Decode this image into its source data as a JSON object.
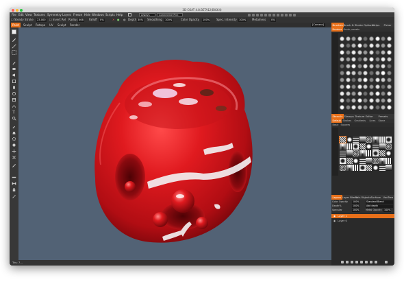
{
  "window": {
    "title": "3D-COAT 4.8.BETA12(BIG64)"
  },
  "menu": {
    "items": [
      "File",
      "Edit",
      "View",
      "Textures",
      "Symmetry",
      "Layers",
      "Freeze",
      "Hide",
      "Windows",
      "Scripts",
      "Help"
    ],
    "workspace_mode": "Always",
    "connective_label": "Connective Pick"
  },
  "tool_options": {
    "steady_label": "Steady Stroke",
    "steady_value": "23.000",
    "invert_label": "Invert Rel",
    "radius_label": "Radius",
    "radius_value": "468",
    "falloff_label": "Falloff",
    "falloff_value": "0%",
    "depth_label": "Depth",
    "depth_value": "30%",
    "smoothing_label": "Smoothing",
    "smoothing_value": "100%",
    "color_opacity_label": "Color Opacity",
    "color_opacity_value": "100%",
    "spec_intensity_label": "Spec. Intensity",
    "spec_intensity_value": "100%",
    "metalness_label": "Metalness",
    "metalness_value": "0%"
  },
  "rooms": [
    "Paint",
    "Sculpt",
    "Retopo",
    "UV",
    "Sculpt",
    "Render"
  ],
  "camera_label": "[Camera]",
  "status_text": "Tris: 7…",
  "right_panel": {
    "top_tabs": [
      "Brushes",
      "Brush & Stroke Options",
      "Strips",
      "Picker"
    ],
    "brush_subtabs": [
      "Brushes",
      "Brush presets"
    ],
    "stroke_tabs": [
      "Stencils",
      "Stamps",
      "Texture Editor",
      "Presets"
    ],
    "stroke_subtabs": [
      "Default",
      "Strokes",
      "Gradients",
      "Lines",
      "Stone"
    ],
    "stroke_subtab2": [
      "Basic",
      "Squares"
    ],
    "layer_tabs": [
      "Layers",
      "Layer Blend",
      "Sub-Objects",
      "Surface",
      "VoxTree"
    ],
    "layer_props": [
      {
        "label": "Color Opacity",
        "value": "100%",
        "mode": "Standard Blend"
      },
      {
        "label": "Depth%",
        "value": "100%",
        "mode": "Add depth"
      },
      {
        "label": "Specular",
        "value": "100%",
        "mode": "Metal Opacity"
      }
    ],
    "metal_value": "100%",
    "layers": [
      "Layer 1",
      "Layer 0"
    ]
  },
  "colors": {
    "accent": "#e8701a",
    "viewport_bg": "#526275",
    "panel_bg": "#2a2a2a",
    "object_red": "#d0181e"
  }
}
